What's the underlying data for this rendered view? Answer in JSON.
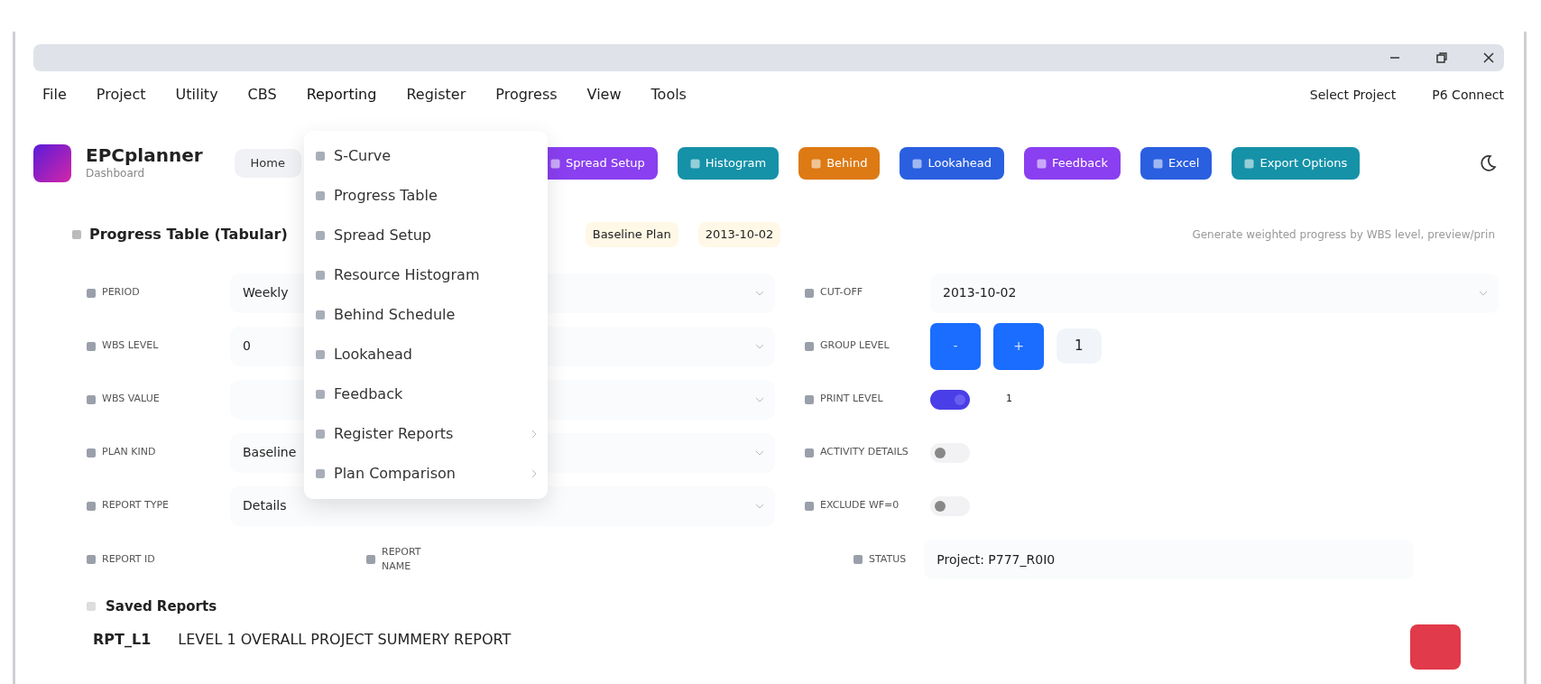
{
  "menu": [
    {
      "label": "File",
      "expanded": false
    },
    {
      "label": "Project",
      "expanded": false
    },
    {
      "label": "Utility",
      "expanded": false
    },
    {
      "label": "CBS",
      "expanded": false
    },
    {
      "label": "Reporting",
      "expanded": true
    },
    {
      "label": "Register",
      "expanded": false
    },
    {
      "label": "Progress",
      "expanded": false
    },
    {
      "label": "View",
      "expanded": false
    },
    {
      "label": "Tools",
      "expanded": false
    }
  ],
  "menu_right": [
    "Select Project",
    "P6 Connect"
  ],
  "app": {
    "name": "EPCplanner",
    "subtitle": "Dashboard",
    "home": "Home"
  },
  "toolbar": [
    {
      "label": "Spread Setup",
      "color": "#8a3ff0"
    },
    {
      "label": "Histogram",
      "color": "#1592a8"
    },
    {
      "label": "Behind",
      "color": "#dd7a14"
    },
    {
      "label": "Lookahead",
      "color": "#2a5fe0"
    },
    {
      "label": "Feedback",
      "color": "#8a3ff0"
    },
    {
      "label": "Excel",
      "color": "#2a5fe0"
    },
    {
      "label": "Export Options",
      "color": "#1592a8"
    }
  ],
  "dropdown": [
    {
      "label": "S-Curve",
      "submenu": false
    },
    {
      "label": "Progress Table",
      "submenu": false
    },
    {
      "label": "Spread Setup",
      "submenu": false
    },
    {
      "label": "Resource Histogram",
      "submenu": false
    },
    {
      "label": "Behind Schedule",
      "submenu": false
    },
    {
      "label": "Lookahead",
      "submenu": false
    },
    {
      "label": "Feedback",
      "submenu": false
    },
    {
      "label": "Register Reports",
      "submenu": true
    },
    {
      "label": "Plan Comparison",
      "submenu": true
    }
  ],
  "section": {
    "title": "Progress Table (Tabular)",
    "chips": [
      "Baseline Plan",
      "2013-10-02"
    ],
    "description": "Generate weighted progress by WBS level, preview/prin"
  },
  "fields_left": [
    {
      "label": "PERIOD",
      "kind": "select",
      "value": "Weekly"
    },
    {
      "label": "WBS LEVEL",
      "kind": "select",
      "value": "0"
    },
    {
      "label": "WBS VALUE",
      "kind": "select"
    },
    {
      "label": "PLAN KIND",
      "kind": "select",
      "value": "Baseline"
    },
    {
      "label": "REPORT TYPE",
      "kind": "select",
      "value": "Details"
    }
  ],
  "fields_right": [
    {
      "label": "CUT-OFF",
      "kind": "select",
      "value": "2013-10-02"
    },
    {
      "label": "GROUP LEVEL",
      "kind": "stepper",
      "value": "1",
      "buttons": [
        "-",
        "+"
      ]
    },
    {
      "label": "PRINT LEVEL",
      "kind": "toggle",
      "on": true,
      "value": "1"
    },
    {
      "label": "ACTIVITY DETAILS",
      "kind": "toggle",
      "on": false
    },
    {
      "label": "EXCLUDE WF=0",
      "kind": "toggle",
      "on": false
    }
  ],
  "report_row": {
    "id_label": "REPORT ID",
    "name_label": "REPORT NAME",
    "status_label": "STATUS",
    "status_value": "Project: P777_R0I0"
  },
  "saved": {
    "title": "Saved Reports",
    "rows": [
      {
        "id": "RPT_L1",
        "title": "LEVEL 1 OVERALL PROJECT SUMMERY REPORT"
      }
    ]
  }
}
